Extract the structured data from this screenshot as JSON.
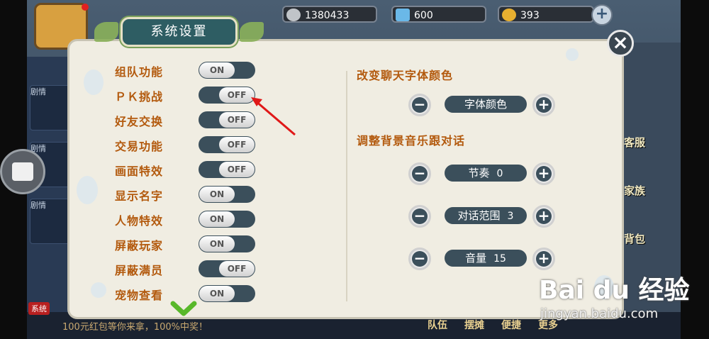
{
  "currency": {
    "silver": "1380433",
    "crystal": "600",
    "gold": "393"
  },
  "dialog": {
    "title": "系统设置",
    "close_icon": "close-icon",
    "options": [
      {
        "label": "组队功能",
        "state": "ON"
      },
      {
        "label": "ＰＫ挑战",
        "state": "OFF"
      },
      {
        "label": "好友交换",
        "state": "OFF"
      },
      {
        "label": "交易功能",
        "state": "OFF"
      },
      {
        "label": "画面特效",
        "state": "OFF"
      },
      {
        "label": "显示名字",
        "state": "ON"
      },
      {
        "label": "人物特效",
        "state": "ON"
      },
      {
        "label": "屏蔽玩家",
        "state": "ON"
      },
      {
        "label": "屏蔽满员",
        "state": "OFF"
      },
      {
        "label": "宠物查看",
        "state": "ON"
      }
    ],
    "chat_color": {
      "heading": "改变聊天字体颜色",
      "button_label": "字体颜色"
    },
    "bgm": {
      "heading": "调整背景音乐跟对话",
      "items": [
        {
          "label": "节奏",
          "value": "0"
        },
        {
          "label": "对话范围",
          "value": "3"
        },
        {
          "label": "音量",
          "value": "15"
        }
      ]
    }
  },
  "background": {
    "right_labels": [
      "客服",
      "家族",
      "背包"
    ],
    "bottom_buttons": [
      "队伍",
      "摆摊",
      "便捷",
      "更多"
    ],
    "system_tag": "系统",
    "ticker": "100元红包等你来拿，100%中奖！",
    "quest_tag": "剧情"
  },
  "watermark": {
    "brand": "Bai du 经验",
    "url": "jingyan.baidu.com"
  },
  "colors": {
    "accent_orange": "#b35a0e",
    "toggle_dark": "#3b4f5b",
    "panel_bg": "#f0ede2",
    "arrow_red": "#e01818"
  }
}
